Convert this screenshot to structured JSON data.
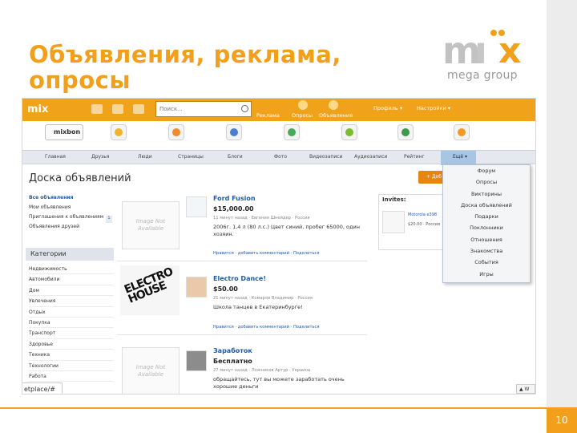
{
  "slide": {
    "title_line1": "Объявления, реклама,",
    "title_line2": "опросы",
    "page_number": "10",
    "accent_color": "#f2a01c"
  },
  "logo": {
    "word_left": "m",
    "word_right": "x",
    "tagline": "mega group"
  },
  "topbar": {
    "logo_text": "mix",
    "search_placeholder": "Поиск...",
    "links": [
      "Реклама",
      "Опросы",
      "Объявления"
    ],
    "menus": [
      "Профиль ▾",
      "Настройки ▾"
    ]
  },
  "apps": {
    "mixbon": "mixbon",
    "icons": [
      "dollar-app-icon",
      "chart-app-icon",
      "chart2-app-icon",
      "pie-app-icon",
      "people-app-icon",
      "target-app-icon",
      "person-app-icon",
      "rss-app-icon"
    ]
  },
  "nav": {
    "items": [
      "Главная",
      "Друзья",
      "Люди",
      "Страницы",
      "Блоги",
      "Фото",
      "Видеозаписи",
      "Аудиозаписи",
      "Рейтинг"
    ],
    "more": "Ещё ▾"
  },
  "page": {
    "heading": "Доска объявлений",
    "add_button": "+ Доб"
  },
  "left": {
    "links": [
      "Все объявления",
      "Мои объявления",
      "Приглашения к объявлениям",
      "Объявления друзей"
    ],
    "invites_count": "1",
    "categories_heading": "Категории",
    "categories": [
      "Недвижимость",
      "Автомобили",
      "Дом",
      "Увлечения",
      "Отдых",
      "Покупка",
      "Транспорт",
      "Здоровье",
      "Техника",
      "Технологии",
      "Работа"
    ],
    "status_url": "etplace/#"
  },
  "listings": [
    {
      "image_text": "Image Not Available",
      "title": "Ford Fusion",
      "price": "$15,000.00",
      "meta": "11 минут назад · Евгения Шнейдер · Россия",
      "desc": "2006г. 1,4 л (80 л.с.) Цвет синий, пробег 65000, один хозяин.",
      "actions": "Нравится · добавить комментарий · Поделиться"
    },
    {
      "image_text": "ELECTRO HOUSE",
      "title": "Electro Dance!",
      "price": "$50.00",
      "meta": "21 минут назад · Комаров Владимир · Россия",
      "desc": "Школа танцев в Екатеринбурге!",
      "actions": "Нравится · добавить комментарий · Поделиться"
    },
    {
      "image_text": "Image Not Available",
      "title": "Заработок",
      "price": "Бесплатно",
      "meta": "27 минут назад · Ложников Артур · Украина",
      "desc": "обращайтесь, тут вы можете заработать очень хорошие деньги",
      "actions": ""
    }
  ],
  "invites": {
    "heading": "Invites:",
    "item_title": "Motorola e398",
    "item_price": "$20.00 · Россия"
  },
  "dropdown": {
    "items": [
      "Форум",
      "Опросы",
      "Викторины",
      "Доска объявлений",
      "Подарки",
      "Поклонники",
      "Отношения",
      "Знакомства",
      "События",
      "Игры"
    ]
  },
  "corner_button": "▲ W"
}
